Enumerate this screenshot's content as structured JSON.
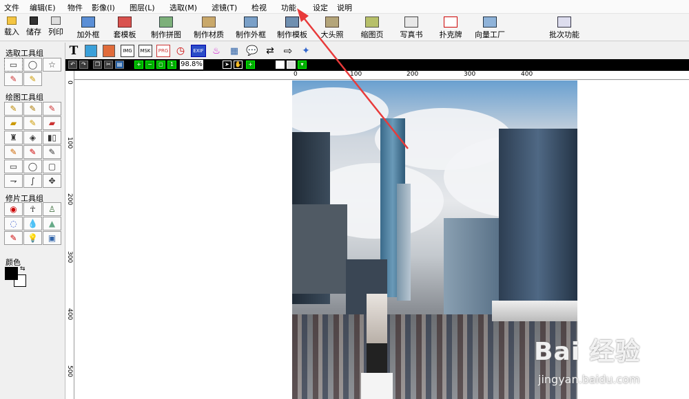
{
  "menu": {
    "items": [
      {
        "label": "文件"
      },
      {
        "label": "编辑(E)"
      },
      {
        "label": "物件"
      },
      {
        "label": "影像(I)"
      },
      {
        "label": "图层(L)"
      },
      {
        "label": "选取(M)"
      },
      {
        "label": "滤镜(T)"
      },
      {
        "label": "检视"
      },
      {
        "label": "功能"
      },
      {
        "label": "设定"
      },
      {
        "label": "说明"
      }
    ]
  },
  "toolbar": {
    "buttons": [
      {
        "label": "载入",
        "icon": "folder-open-icon"
      },
      {
        "label": "储存",
        "icon": "floppy-disk-icon"
      },
      {
        "label": "列印",
        "icon": "printer-icon"
      },
      {
        "label": "加外框",
        "icon": "frame-icon"
      },
      {
        "label": "套模板",
        "icon": "template-icon"
      },
      {
        "label": "制作拼图",
        "icon": "puzzle-icon"
      },
      {
        "label": "制作材质",
        "icon": "texture-icon"
      },
      {
        "label": "制作外框",
        "icon": "make-frame-icon"
      },
      {
        "label": "制作模板",
        "icon": "make-template-icon"
      },
      {
        "label": "大头照",
        "icon": "portrait-icon"
      },
      {
        "label": "缩图页",
        "icon": "thumbnail-icon"
      },
      {
        "label": "写真书",
        "icon": "photo-book-icon"
      },
      {
        "label": "扑克牌",
        "icon": "playing-cards-icon"
      },
      {
        "label": "向量工厂",
        "icon": "vector-factory-icon"
      },
      {
        "label": "批次功能",
        "icon": "batch-icon"
      }
    ]
  },
  "left_panel": {
    "select_group_title": "选取工具组",
    "draw_group_title": "绘图工具组",
    "retouch_group_title": "修片工具组",
    "color_title": "颜色"
  },
  "toolbar2": {
    "labels": [
      "T",
      "IMG",
      "MSK",
      "PRG",
      "EXIF"
    ]
  },
  "image_toolbar": {
    "zoom": "98.8%"
  },
  "rulers": {
    "top": [
      "0",
      "100",
      "200",
      "300",
      "400"
    ],
    "left": [
      "0",
      "100",
      "200",
      "300",
      "400",
      "500"
    ]
  },
  "watermark": {
    "brand": "Bai 经验",
    "url": "jingyan.baidu.com"
  },
  "colors": {
    "annotation_arrow": "#e83a3a",
    "foreground": "#000000",
    "background": "#ffffff"
  }
}
